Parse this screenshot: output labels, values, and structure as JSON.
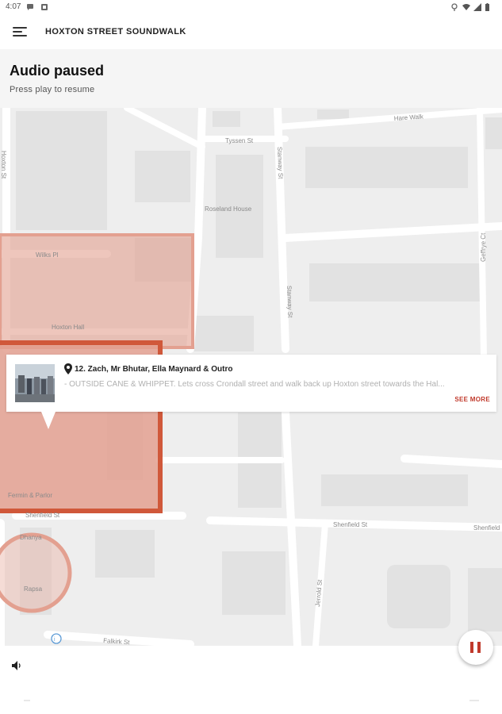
{
  "status_bar": {
    "time": "4:07"
  },
  "app_bar": {
    "title": "HOXTON STREET SOUNDWALK"
  },
  "audio": {
    "title": "Audio paused",
    "subtitle": "Press play to resume"
  },
  "map": {
    "streets": {
      "hare_walk": "Hare Walk",
      "tyssen_st": "Tyssen St",
      "stanway_st_upper": "Stanway St",
      "stanway_st_lower": "Stanway St",
      "buttoner": "Hoxton St",
      "roseland_house": "Roseland House",
      "wilks_pl": "Wilks Pl",
      "hoxton_hall": "Hoxton Hall",
      "geffrye_ct": "Geffrye Ct",
      "shenfield_st_left": "Shenfield St",
      "shenfield_st_mid": "Shenfield St",
      "shenfield_st_right": "Shenfield",
      "fermin_parlor": "Fermin & Parlor",
      "dhanya": "Dhanya",
      "rapsa": "Rapsa",
      "jerrold_st": "Jerrold St",
      "falkirk_st": "Falkirk St"
    },
    "colors": {
      "zone_fill": "#e3a090",
      "zone_border": "#d0583a",
      "accent": "#c0392b"
    }
  },
  "card": {
    "title": "12. Zach, Mr Bhutar, Ella Maynard & Outro",
    "description": "- OUTSIDE CANE & WHIPPET. Lets cross Crondall street and walk back up Hoxton street towards the Hal...",
    "see_more": "SEE MORE"
  },
  "player": {
    "state": "paused",
    "volume_icon": "volume-icon",
    "pause_icon": "pause-icon"
  }
}
